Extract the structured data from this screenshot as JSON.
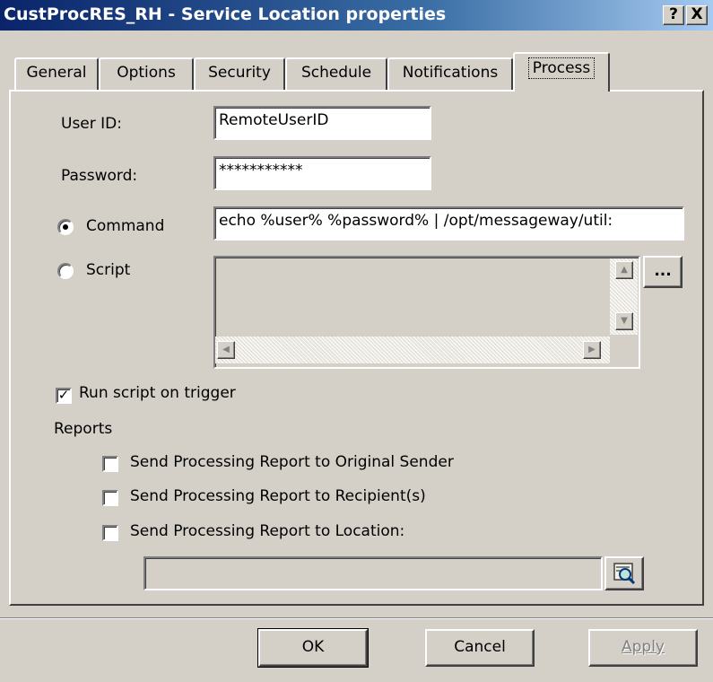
{
  "window": {
    "title": "CustProcRES_RH - Service Location properties",
    "help_label": "?",
    "close_label": "X"
  },
  "tabs": [
    {
      "label": "General",
      "active": false
    },
    {
      "label": "Options",
      "active": false
    },
    {
      "label": "Security",
      "active": false
    },
    {
      "label": "Schedule",
      "active": false
    },
    {
      "label": "Notifications",
      "active": false
    },
    {
      "label": "Process",
      "active": true
    }
  ],
  "form": {
    "user_id_label": "User ID:",
    "user_id_value": "RemoteUserID",
    "password_label": "Password:",
    "password_value": "***********",
    "command_label": "Command",
    "command_selected": true,
    "command_value": "echo %user% %password% | /opt/messageway/util:",
    "script_label": "Script",
    "script_value": "",
    "ellipsis_label": "...",
    "run_script_label": "Run script on trigger",
    "run_script_checked": true,
    "reports_label": "Reports",
    "report_original_sender_label": "Send Processing Report to Original Sender",
    "report_recipients_label": "Send Processing Report to Recipient(s)",
    "report_location_label": "Send Processing Report to Location:",
    "location_value": ""
  },
  "buttons": {
    "ok": "OK",
    "cancel": "Cancel",
    "apply": "Apply"
  },
  "icons": {
    "browse": "browse-location-icon"
  }
}
